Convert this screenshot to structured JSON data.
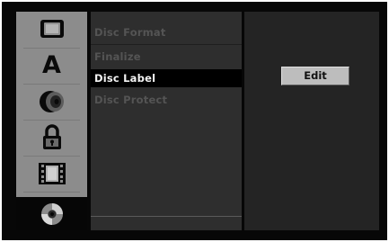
{
  "sidebar": {
    "items": [
      {
        "icon": "tv-screen-icon",
        "selected": false
      },
      {
        "icon": "language-icon",
        "label": "A",
        "selected": false
      },
      {
        "icon": "speaker-icon",
        "selected": false
      },
      {
        "icon": "padlock-icon",
        "selected": false
      },
      {
        "icon": "film-icon",
        "selected": false
      },
      {
        "icon": "disc-icon",
        "selected": true
      }
    ]
  },
  "menu": {
    "items": [
      {
        "label": "Disc Format"
      },
      {
        "label": "Finalize"
      },
      {
        "label": "Disc Label",
        "active": true
      },
      {
        "label": "Disc Protect"
      }
    ]
  },
  "options": {
    "edit_label": "Edit"
  },
  "colors": {
    "background": "#070707",
    "sidebar": "#8c8c8c",
    "menu_panel": "#2e2e2e",
    "active_item": "#000000",
    "inactive_text": "#545454",
    "button_face": "#bdbdbd"
  }
}
